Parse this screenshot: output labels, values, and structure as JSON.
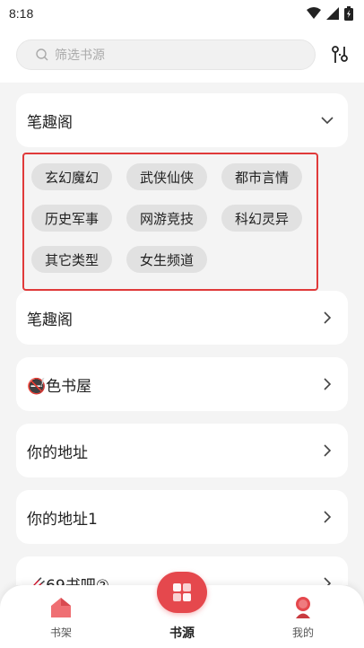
{
  "status": {
    "time": "8:18"
  },
  "search": {
    "placeholder": "筛选书源"
  },
  "sources": {
    "expanded_title": "笔趣阁",
    "tags": [
      "玄幻魔幻",
      "武侠仙侠",
      "都市言情",
      "历史军事",
      "网游竞技",
      "科幻灵异",
      "其它类型",
      "女生频道"
    ],
    "items": [
      {
        "label": "笔趣阁"
      },
      {
        "label": "🚭色书屋"
      },
      {
        "label": "你的地址"
      },
      {
        "label": "你的地址1"
      },
      {
        "label": "🥢69书吧②"
      }
    ]
  },
  "nav": {
    "bookshelf": "书架",
    "sources": "书源",
    "mine": "我的"
  },
  "colors": {
    "accent": "#e5484d",
    "highlight_border": "#e03a3a"
  }
}
